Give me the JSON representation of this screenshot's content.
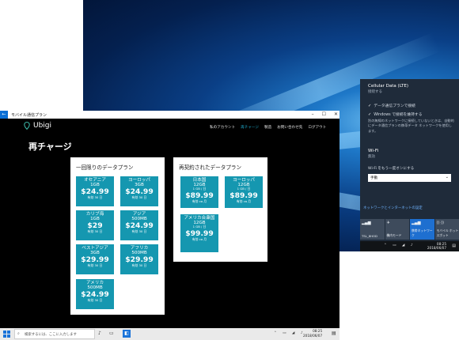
{
  "window": {
    "title": "モバイル通信プラン",
    "back_icon": "back-arrow-icon",
    "controls": [
      "–",
      "☐",
      "✕"
    ]
  },
  "app": {
    "brand": "Ubigi",
    "nav": [
      {
        "label": "私のアカウント",
        "active": false
      },
      {
        "label": "再チャージ",
        "active": true
      },
      {
        "label": "製造",
        "active": false
      },
      {
        "label": "お問い合わせ先",
        "active": false
      },
      {
        "label": "ログアウト",
        "active": false
      }
    ],
    "heading": "再チャージ",
    "accent_color": "#1597b0"
  },
  "once_plans": {
    "title": "一回限りのデータプラン",
    "cards": [
      {
        "region": "オセアニア",
        "data": "1GB",
        "price": "$24.99",
        "validity": "有効 30 日"
      },
      {
        "region": "ヨーロッパ",
        "data": "3GB",
        "price": "$24.99",
        "validity": "有効 30 日"
      },
      {
        "region": "カリブ海",
        "data": "1GB",
        "price": "$29",
        "validity": "有効 30 日"
      },
      {
        "region": "アジア",
        "data": "500MB",
        "price": "$24.99",
        "validity": "有効 30 日"
      },
      {
        "region": "ベストアジア",
        "data": "3GB",
        "price": "$29.99",
        "validity": "有効 30 日"
      },
      {
        "region": "アフリカ",
        "data": "500MB",
        "price": "$29.99",
        "validity": "有効 30 日"
      },
      {
        "region": "アメリカ",
        "data": "500MB",
        "price": "$24.99",
        "validity": "有効 30 日"
      }
    ]
  },
  "renew_plans": {
    "title": "再契約されたデータプラン",
    "cards": [
      {
        "region": "日本国",
        "data": "12GB",
        "sub": "1 GB / 日",
        "price": "$89.99",
        "validity": "有効 ca 月"
      },
      {
        "region": "ヨーロッパ",
        "data": "12GB",
        "sub": "1 GB / 日",
        "price": "$89.99",
        "validity": "有効 ca 月"
      },
      {
        "region": "アメリカ合衆国",
        "data": "12GB",
        "sub": "1 GB / 日",
        "price": "$99.99",
        "validity": "有効 ca 月"
      }
    ]
  },
  "action_center": {
    "cellular_title": "Cellular Data (LTE)",
    "cellular_status": "接続する",
    "option_connect": "データ通信プランで接続",
    "option_windows": "Windows で接続を維持する",
    "info": "別の無線のネットワークに接続していないときは、自動的にデータ通信プランの携帯データ ネットワークを使用します。",
    "wifi_title": "Wi-Fi",
    "wifi_status": "無効",
    "wifi_label": "Wi-Fi をもう一度オンにする",
    "wifi_select": "手動",
    "network_link": "ネットワークとインターネットの設定",
    "tiles": [
      {
        "label": "TSL_8HOD",
        "active": false,
        "icon": "cellular-icon"
      },
      {
        "label": "機内モード",
        "active": false,
        "icon": "airplane-icon"
      },
      {
        "label": "携帯ネットワーク",
        "active": true,
        "icon": "cellular-icon"
      },
      {
        "label": "モバイル ホットスポット",
        "active": false,
        "icon": "hotspot-icon"
      }
    ],
    "time": "08:25",
    "date": "2018/06/07"
  },
  "taskbar": {
    "search_placeholder": "検索するには、ここに入力します",
    "time": "08:25",
    "date": "2018/06/07"
  }
}
